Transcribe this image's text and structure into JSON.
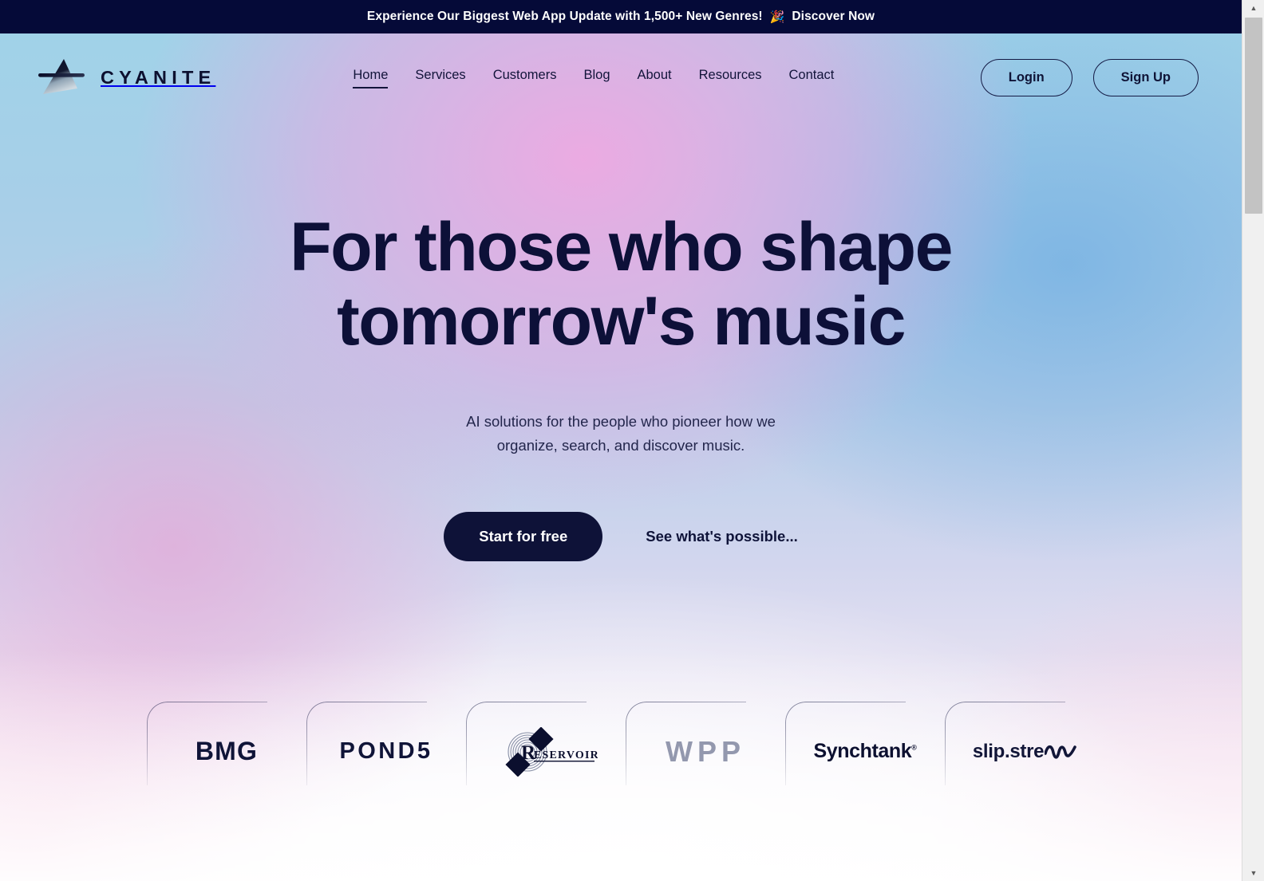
{
  "announcement": {
    "text": "Experience Our Biggest Web App Update with 1,500+ New Genres!",
    "emoji": "🎉",
    "link_label": "Discover Now",
    "background_color": "#050a38",
    "text_color": "#ffffff"
  },
  "header": {
    "brand": {
      "name": "CYANITE",
      "mark_icon": "triangle-play-mark-icon"
    },
    "nav": [
      {
        "label": "Home",
        "active": true
      },
      {
        "label": "Services",
        "active": false
      },
      {
        "label": "Customers",
        "active": false
      },
      {
        "label": "Blog",
        "active": false
      },
      {
        "label": "About",
        "active": false
      },
      {
        "label": "Resources",
        "active": false
      },
      {
        "label": "Contact",
        "active": false
      }
    ],
    "auth": {
      "login_label": "Login",
      "signup_label": "Sign Up"
    }
  },
  "hero": {
    "title_line1": "For those who shape",
    "title_line2": "tomorrow's music",
    "subtitle_line1": "AI solutions for the people who pioneer how we",
    "subtitle_line2": "organize, search, and discover music.",
    "primary_cta": "Start for free",
    "secondary_cta": "See what's possible...",
    "title_color": "#0d1038",
    "primary_cta_bg": "#0e1238"
  },
  "logos": {
    "items": [
      {
        "name": "BMG",
        "icon": "bmg-logo"
      },
      {
        "name": "POND5",
        "icon": "pond5-logo"
      },
      {
        "name": "RESERVOIR",
        "icon": "reservoir-logo"
      },
      {
        "name": "WPP",
        "icon": "wpp-logo"
      },
      {
        "name": "Synchtank",
        "icon": "synchtank-logo",
        "trademark": "®"
      },
      {
        "name": "slip.stream",
        "icon": "slipstream-logo"
      }
    ]
  },
  "scrollbar": {
    "up_arrow": "▲",
    "down_arrow": "▼"
  },
  "theme": {
    "gradient_left": "#9fd3e8",
    "gradient_center_pink": "#dfa9df",
    "gradient_right_blue": "#7fb3e0",
    "gradient_bottom": "#fbf8fb",
    "ink": "#0d1038"
  }
}
